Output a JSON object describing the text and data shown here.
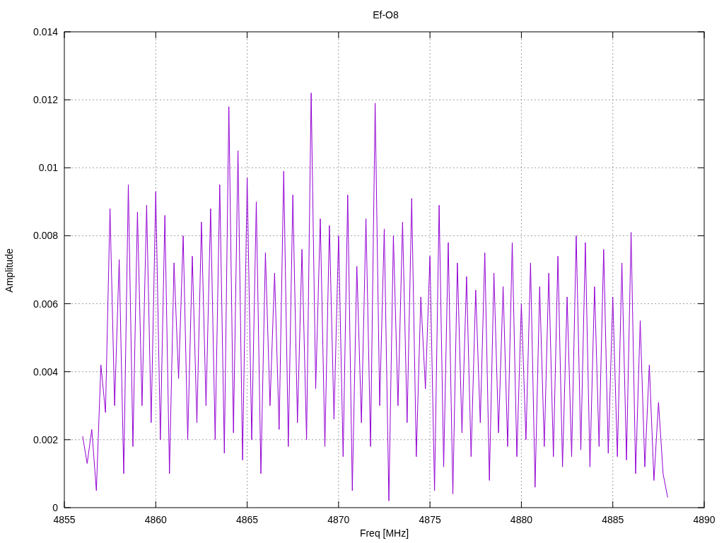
{
  "chart_data": {
    "type": "line",
    "title": "Ef-O8",
    "xlabel": "Freq [MHz]",
    "ylabel": "Amplitude",
    "grid": true,
    "xlim": [
      4855,
      4890
    ],
    "ylim": [
      0,
      0.014
    ],
    "xticks": [
      4855,
      4860,
      4865,
      4870,
      4875,
      4880,
      4885,
      4890
    ],
    "yticks": [
      {
        "value": 0,
        "label": "0"
      },
      {
        "value": 0.002,
        "label": "0.002"
      },
      {
        "value": 0.004,
        "label": "0.004"
      },
      {
        "value": 0.006,
        "label": "0.006"
      },
      {
        "value": 0.008,
        "label": "0.008"
      },
      {
        "value": 0.01,
        "label": "0.01"
      },
      {
        "value": 0.012,
        "label": "0.012"
      },
      {
        "value": 0.014,
        "label": "0.014"
      }
    ],
    "x": [
      4856,
      4856.25,
      4856.5,
      4856.75,
      4857,
      4857.25,
      4857.5,
      4857.75,
      4858,
      4858.25,
      4858.5,
      4858.75,
      4859,
      4859.25,
      4859.5,
      4859.75,
      4860,
      4860.25,
      4860.5,
      4860.75,
      4861,
      4861.25,
      4861.5,
      4861.75,
      4862,
      4862.25,
      4862.5,
      4862.75,
      4863,
      4863.25,
      4863.5,
      4863.75,
      4864,
      4864.25,
      4864.5,
      4864.75,
      4865,
      4865.25,
      4865.5,
      4865.75,
      4866,
      4866.25,
      4866.5,
      4866.75,
      4867,
      4867.25,
      4867.5,
      4867.75,
      4868,
      4868.25,
      4868.5,
      4868.75,
      4869,
      4869.25,
      4869.5,
      4869.75,
      4870,
      4870.25,
      4870.5,
      4870.75,
      4871,
      4871.25,
      4871.5,
      4871.75,
      4872,
      4872.25,
      4872.5,
      4872.75,
      4873,
      4873.25,
      4873.5,
      4873.75,
      4874,
      4874.25,
      4874.5,
      4874.75,
      4875,
      4875.25,
      4875.5,
      4875.75,
      4876,
      4876.25,
      4876.5,
      4876.75,
      4877,
      4877.25,
      4877.5,
      4877.75,
      4878,
      4878.25,
      4878.5,
      4878.75,
      4879,
      4879.25,
      4879.5,
      4879.75,
      4880,
      4880.25,
      4880.5,
      4880.75,
      4881,
      4881.25,
      4881.5,
      4881.75,
      4882,
      4882.25,
      4882.5,
      4882.75,
      4883,
      4883.25,
      4883.5,
      4883.75,
      4884,
      4884.25,
      4884.5,
      4884.75,
      4885,
      4885.25,
      4885.5,
      4885.75,
      4886,
      4886.25,
      4886.5,
      4886.75,
      4887,
      4887.25,
      4887.5,
      4887.75,
      4888
    ],
    "series": [
      {
        "color": "#9400d3",
        "values": [
          0.0021,
          0.0013,
          0.0023,
          0.0005,
          0.0042,
          0.0028,
          0.0088,
          0.003,
          0.0073,
          0.001,
          0.0095,
          0.0018,
          0.0087,
          0.003,
          0.0089,
          0.0025,
          0.0093,
          0.002,
          0.0086,
          0.001,
          0.0072,
          0.0038,
          0.008,
          0.002,
          0.0074,
          0.0025,
          0.0084,
          0.003,
          0.0088,
          0.002,
          0.0095,
          0.0016,
          0.0118,
          0.0022,
          0.0105,
          0.0014,
          0.0097,
          0.002,
          0.009,
          0.001,
          0.0075,
          0.003,
          0.0069,
          0.0023,
          0.0099,
          0.0018,
          0.0092,
          0.0025,
          0.0076,
          0.002,
          0.0122,
          0.0035,
          0.0085,
          0.0018,
          0.0083,
          0.0026,
          0.008,
          0.0015,
          0.0092,
          0.0005,
          0.0071,
          0.0025,
          0.0085,
          0.0018,
          0.0119,
          0.003,
          0.0082,
          0.0002,
          0.008,
          0.003,
          0.0084,
          0.0025,
          0.0091,
          0.0015,
          0.0062,
          0.0035,
          0.0074,
          0.0005,
          0.0089,
          0.0012,
          0.0078,
          0.0004,
          0.0072,
          0.0022,
          0.0068,
          0.0015,
          0.0064,
          0.0025,
          0.0075,
          0.0008,
          0.0069,
          0.0022,
          0.0065,
          0.0018,
          0.0078,
          0.0015,
          0.006,
          0.002,
          0.0072,
          0.0006,
          0.0065,
          0.0018,
          0.0069,
          0.0015,
          0.0074,
          0.0012,
          0.0062,
          0.0015,
          0.008,
          0.0017,
          0.0078,
          0.0012,
          0.0065,
          0.0018,
          0.0076,
          0.0016,
          0.0062,
          0.0015,
          0.0072,
          0.0014,
          0.0081,
          0.001,
          0.0055,
          0.0012,
          0.0042,
          0.0008,
          0.0031,
          0.001,
          0.0003
        ]
      }
    ]
  }
}
